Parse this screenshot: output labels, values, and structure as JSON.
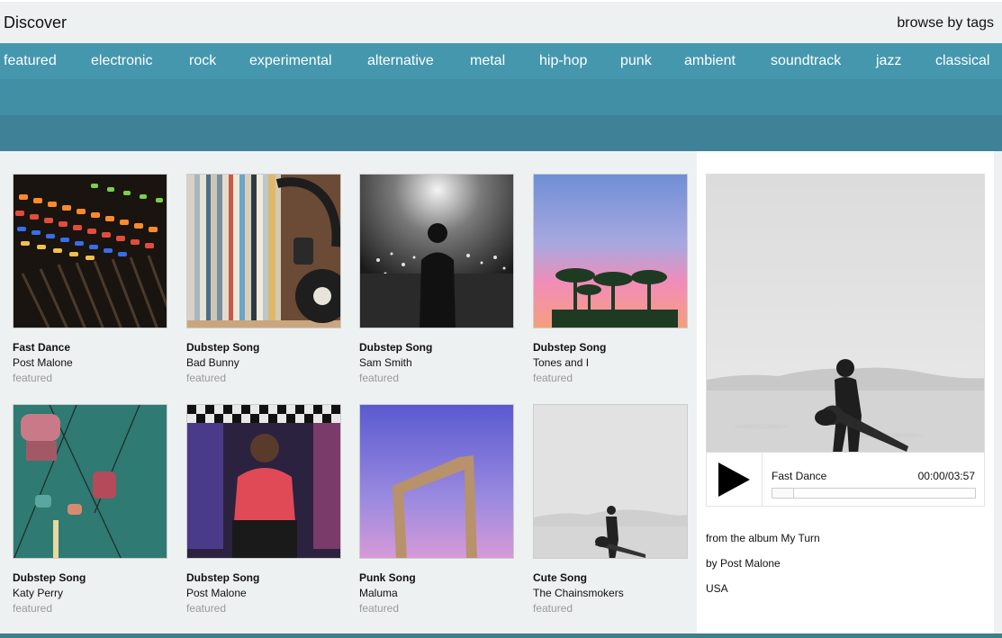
{
  "header": {
    "title": "Discover",
    "browse_label": "browse by tags"
  },
  "tags": [
    "featured",
    "electronic",
    "rock",
    "experimental",
    "alternative",
    "metal",
    "hip-hop",
    "punk",
    "ambient",
    "soundtrack",
    "jazz",
    "classical"
  ],
  "colors": {
    "tagbar": "#4497ad",
    "band2": "#418fa4",
    "band3": "#3f8297",
    "footer": "#3f7f8c"
  },
  "cards": [
    {
      "song": "Fast Dance",
      "artist": "Post Malone",
      "tag": "featured",
      "cover": "mixer-board"
    },
    {
      "song": "Dubstep Song",
      "artist": "Bad Bunny",
      "tag": "featured",
      "cover": "vinyl-records-headphones"
    },
    {
      "song": "Dubstep Song",
      "artist": "Sam Smith",
      "tag": "featured",
      "cover": "concert-crowd"
    },
    {
      "song": "Dubstep Song",
      "artist": "Tones and I",
      "tag": "featured",
      "cover": "palm-trees-sunset"
    },
    {
      "song": "Dubstep Song",
      "artist": "Katy Perry",
      "tag": "featured",
      "cover": "gondola-ride"
    },
    {
      "song": "Dubstep Song",
      "artist": "Post Malone",
      "tag": "featured",
      "cover": "rapper-graffiti"
    },
    {
      "song": "Punk Song",
      "artist": "Maluma",
      "tag": "featured",
      "cover": "dubai-frame"
    },
    {
      "song": "Cute Song",
      "artist": "The Chainsmokers",
      "tag": "featured",
      "cover": "guitarist-desert"
    }
  ],
  "player": {
    "cover": "guitarist-desert",
    "title": "Fast Dance",
    "time": "00:00/03:57",
    "progress": 0,
    "album_line": "from the album My Turn",
    "artist_line": "by Post Malone",
    "country": "USA"
  }
}
